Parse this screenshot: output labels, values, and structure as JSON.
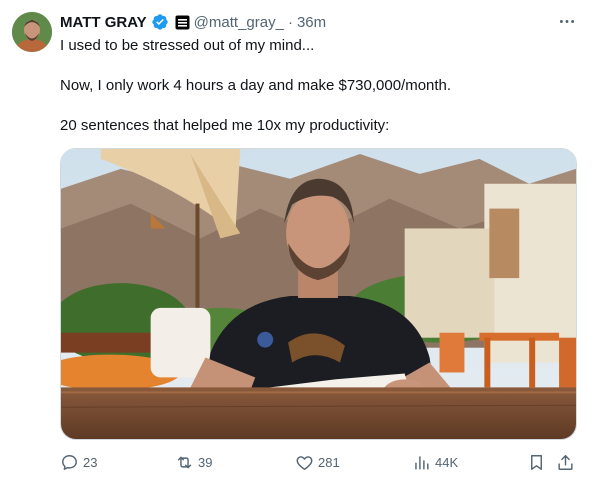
{
  "author": {
    "name": "MATT GRAY",
    "handle": "@matt_gray_",
    "separator": "·",
    "time": "36m",
    "verified_color": "#1d9bf0"
  },
  "tweet": {
    "lines": [
      "I used to be stressed out of my mind...",
      "Now, I only work 4 hours a day and make $730,000/month.",
      "20 sentences that helped me 10x my productivity:"
    ]
  },
  "media": {
    "kind": "photo"
  },
  "actions": {
    "reply_count": "23",
    "retweet_count": "39",
    "like_count": "281",
    "views_count": "44K"
  },
  "icons": {
    "verified": "verified-badge-icon",
    "affiliation": "affiliation-badge-icon",
    "more": "more-options-icon",
    "reply": "reply-icon",
    "retweet": "retweet-icon",
    "like": "heart-icon",
    "views": "views-chart-icon",
    "bookmark": "bookmark-icon",
    "share": "share-icon"
  },
  "colors": {
    "text": "#0f1419",
    "secondary": "#536471",
    "border": "#cfd9de"
  }
}
